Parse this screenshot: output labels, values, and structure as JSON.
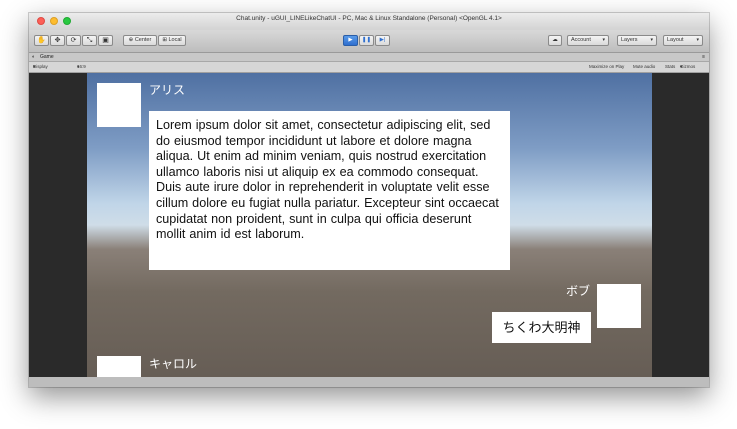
{
  "window": {
    "title": "Chat.unity - uGUI_LINELikeChatUI - PC, Mac & Linux Standalone (Personal) <OpenGL 4.1>"
  },
  "toolbar": {
    "tools": [
      "hand-icon",
      "move-icon",
      "rotate-icon",
      "scale-icon",
      "rect-icon"
    ],
    "center_label": "Center",
    "local_label": "Local",
    "account_label": "Account",
    "layers_label": "Layers",
    "layout_label": "Layout"
  },
  "game_tab": {
    "label": "Game",
    "display_label": "Display 1",
    "aspect_label": "16:9",
    "maximize_label": "Maximize on Play",
    "mute_label": "Mute audio",
    "stats_label": "Stats",
    "gizmos_label": "Gizmos"
  },
  "chat": {
    "messages": [
      {
        "sender": "アリス",
        "text": "Lorem ipsum dolor sit amet, consectetur adipiscing elit, sed do eiusmod tempor incididunt ut labore et dolore magna aliqua. Ut enim ad minim veniam, quis nostrud exercitation ullamco laboris nisi ut aliquip ex ea commodo consequat. Duis aute irure dolor in reprehenderit in voluptate velit esse cillum dolore eu fugiat nulla pariatur. Excepteur sint occaecat cupidatat non proident, sunt in culpa qui officia deserunt mollit anim id est laborum."
      },
      {
        "sender": "ボブ",
        "text": "ちくわ大明神"
      },
      {
        "sender": "キャロル",
        "text": ""
      }
    ]
  },
  "colors": {
    "play_active": "#3a7ddb",
    "sky_top": "#4f70a2",
    "ground": "#6c6259"
  }
}
